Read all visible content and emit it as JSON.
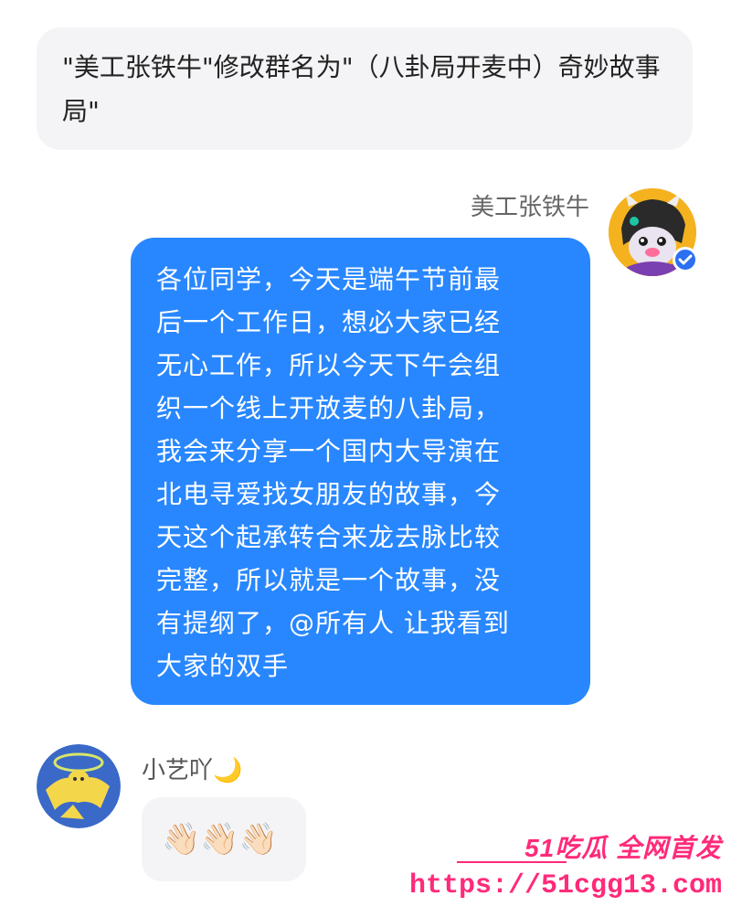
{
  "system_notice": {
    "text": "\"美工张铁牛\"修改群名为\"（八卦局开麦中）奇妙故事局\""
  },
  "messages": [
    {
      "sender": "美工张铁牛",
      "side": "right",
      "verified": true,
      "text": "各位同学，今天是端午节前最\n后一个工作日，想必大家已经\n无心工作，所以今天下午会组\n织一个线上开放麦的八卦局，\n我会来分享一个国内大导演在\n北电寻爱找女朋友的故事，今\n天这个起承转合来龙去脉比较\n完整，所以就是一个故事，没\n有提纲了，@所有人 让我看到\n大家的双手"
    },
    {
      "sender": "小艺吖🌙",
      "side": "left",
      "text": "👋🏻👋🏻👋🏻"
    }
  ],
  "watermark": {
    "brand": "51吃瓜 全网首发",
    "url": "https://51cgg13.com"
  },
  "colors": {
    "bubble_outgoing": "#2887ff",
    "bubble_incoming": "#f4f4f6",
    "watermark": "#ff2a7a"
  }
}
